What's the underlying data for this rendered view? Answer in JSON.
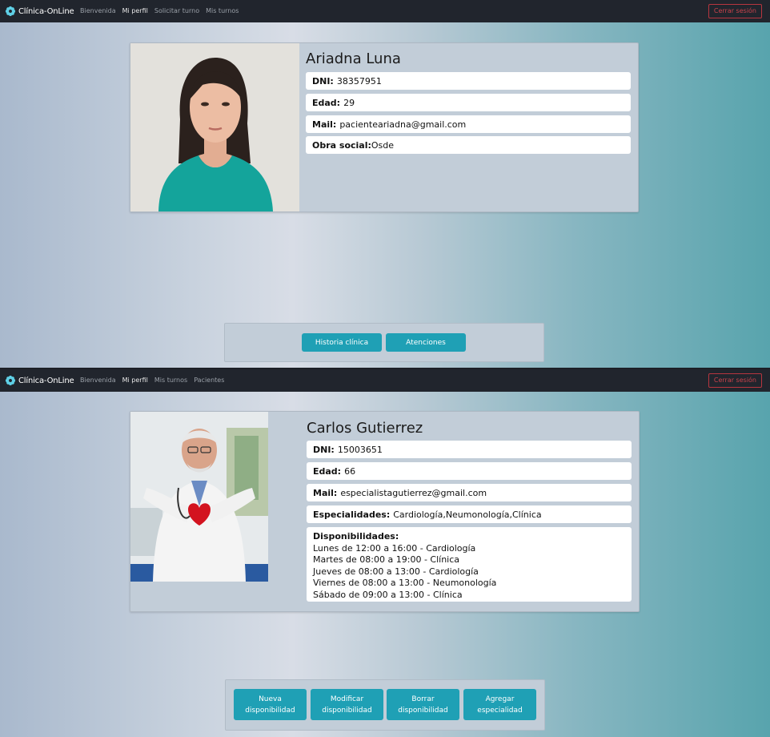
{
  "top": {
    "navbar": {
      "brand": "Clínica-OnLine",
      "links": [
        "Bienvenida",
        "Mi perfil",
        "Solicitar turno",
        "Mis turnos"
      ],
      "logout": "Cerrar sesión"
    },
    "profile": {
      "name": "Ariadna Luna",
      "dni_label": "DNI:",
      "dni": "38357951",
      "edad_label": "Edad:",
      "edad": "29",
      "mail_label": "Mail:",
      "mail": "pacienteariadna@gmail.com",
      "obra_label": "Obra social:",
      "obra": "Osde"
    },
    "buttons": [
      "Historia clínica",
      "Atenciones"
    ]
  },
  "bottom": {
    "navbar": {
      "brand": "Clínica-OnLine",
      "links": [
        "Bienvenida",
        "Mi perfil",
        "Mis turnos",
        "Pacientes"
      ],
      "logout": "Cerrar sesión"
    },
    "profile": {
      "name": "Carlos Gutierrez",
      "dni_label": "DNI:",
      "dni": "15003651",
      "edad_label": "Edad:",
      "edad": "66",
      "mail_label": "Mail:",
      "mail": "especialistagutierrez@gmail.com",
      "esp_label": "Especialidades:",
      "esp": "Cardiología,Neumonología,Clínica",
      "disp_label": "Disponibilidades:",
      "disp": [
        "Lunes de 12:00 a 16:00 - Cardiología",
        "Martes de 08:00 a 19:00 - Clínica",
        "Jueves de 08:00 a 13:00 - Cardiología",
        "Viernes de 08:00 a 13:00 - Neumonología",
        "Sábado de 09:00 a 13:00 - Clínica"
      ]
    },
    "buttons": [
      [
        "Nueva",
        "disponibilidad"
      ],
      [
        "Modificar",
        "disponibilidad"
      ],
      [
        "Borrar",
        "disponibilidad"
      ],
      [
        "Agregar",
        "especialidad"
      ]
    ]
  },
  "colors": {
    "accent": "#1fa0b5",
    "navbar": "#21252d",
    "logout": "#c9424b"
  }
}
